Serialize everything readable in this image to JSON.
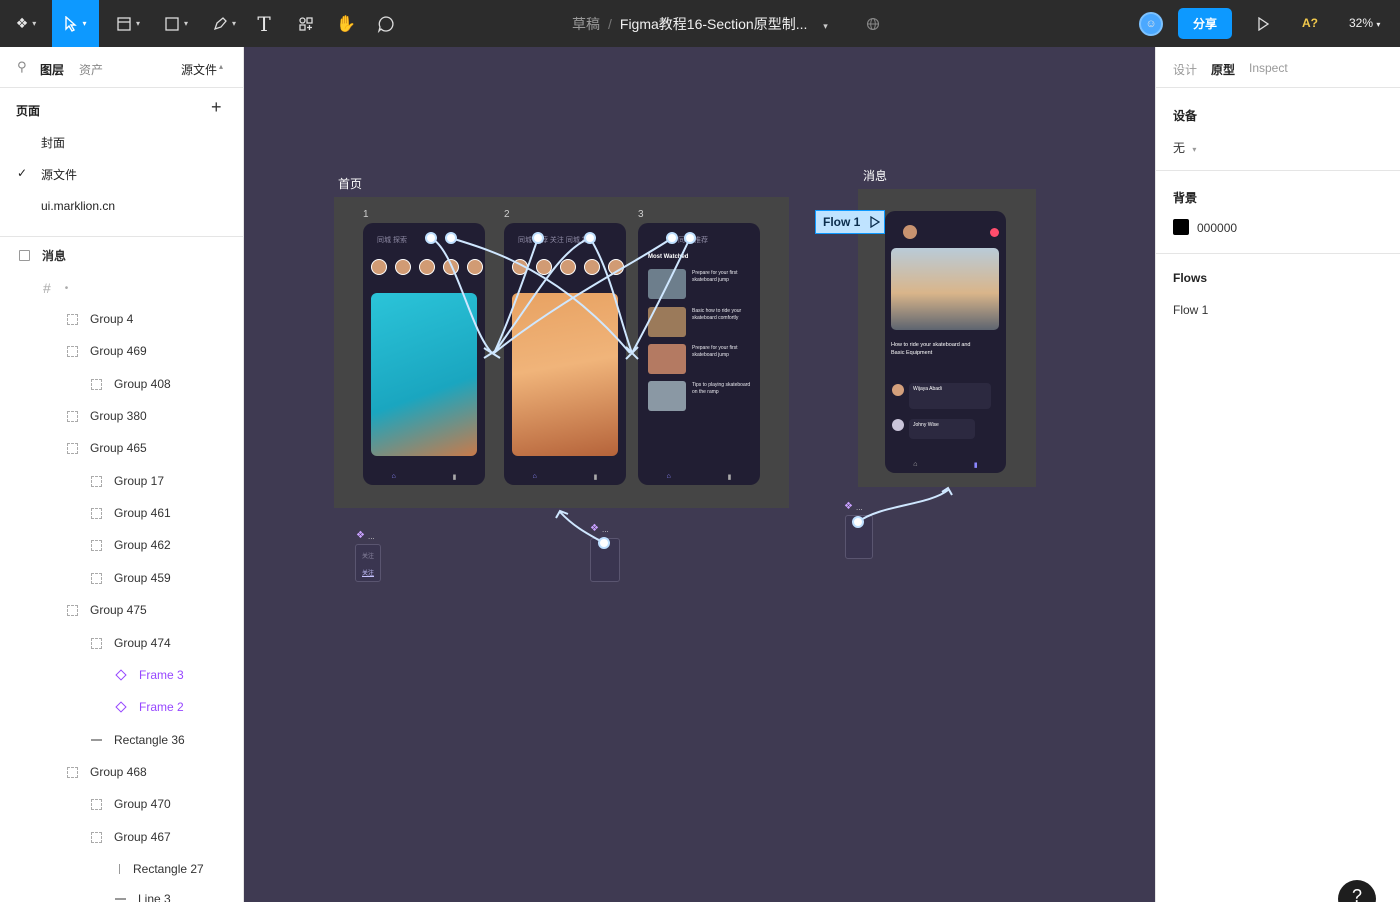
{
  "toolbar": {
    "title_draft": "草稿",
    "title_separator": "/",
    "title_file": "Figma教程16-Section原型制...",
    "share_label": "分享",
    "zoom": "32%",
    "accessibility": "A?"
  },
  "left_panel": {
    "tab_layers": "图层",
    "tab_assets": "资产",
    "current_page_dropdown": "源文件",
    "pages_header": "页面",
    "pages": [
      "封面",
      "源文件",
      "ui.marklion.cn"
    ],
    "section_name": "消息",
    "layers": [
      {
        "label": "Group 4",
        "type": "group"
      },
      {
        "label": "Group 469",
        "type": "group"
      },
      {
        "label": "Group 408",
        "type": "group"
      },
      {
        "label": "Group 380",
        "type": "group"
      },
      {
        "label": "Group 465",
        "type": "group"
      },
      {
        "label": "Group 17",
        "type": "group"
      },
      {
        "label": "Group 461",
        "type": "group"
      },
      {
        "label": "Group 462",
        "type": "group"
      },
      {
        "label": "Group 459",
        "type": "group"
      },
      {
        "label": "Group 475",
        "type": "group"
      },
      {
        "label": "Group 474",
        "type": "group"
      },
      {
        "label": "Frame 3",
        "type": "component"
      },
      {
        "label": "Frame 2",
        "type": "component"
      },
      {
        "label": "Rectangle 36",
        "type": "rect"
      },
      {
        "label": "Group 468",
        "type": "group"
      },
      {
        "label": "Group 470",
        "type": "group"
      },
      {
        "label": "Group 467",
        "type": "group"
      },
      {
        "label": "Rectangle 27",
        "type": "vline"
      },
      {
        "label": "Line 3",
        "type": "rect"
      }
    ]
  },
  "right_panel": {
    "tab_design": "设计",
    "tab_prototype": "原型",
    "tab_inspect": "Inspect",
    "device_header": "设备",
    "device_value": "无",
    "background_header": "背景",
    "background_value": "000000",
    "flows_header": "Flows",
    "flow_item": "Flow 1"
  },
  "canvas": {
    "section_home_label": "首页",
    "section_message_label": "消息",
    "flow_tag": "Flow 1",
    "frame_numbers": [
      "1",
      "2",
      "3"
    ],
    "phone1_tabs": "同城  探索",
    "phone2_tabs": "同城  推荐  关注  同城  推荐",
    "phone3_tabs": "同城  推荐",
    "phone3_heading": "Most Watched",
    "phone3_items": [
      "Prepare for your first skateboard jump",
      "Basic how to ride your skateboard comfortly",
      "Prepare for your first skateboard jump",
      "Tips to playing skateboard on the ramp"
    ],
    "message_video_title": "How to ride your skateboard and Basic Equipment",
    "message_comment1_user": "Wijaya Abadi",
    "message_comment2_user": "Johny Wise",
    "stub1_top": "关注",
    "stub1_bottom": "关注"
  },
  "colors": {
    "canvas_bg": "#3f3a52",
    "accent": "#0d99ff",
    "component_purple": "#9747ff",
    "section_fill": "#454545",
    "phone_bg": "#211e33"
  }
}
